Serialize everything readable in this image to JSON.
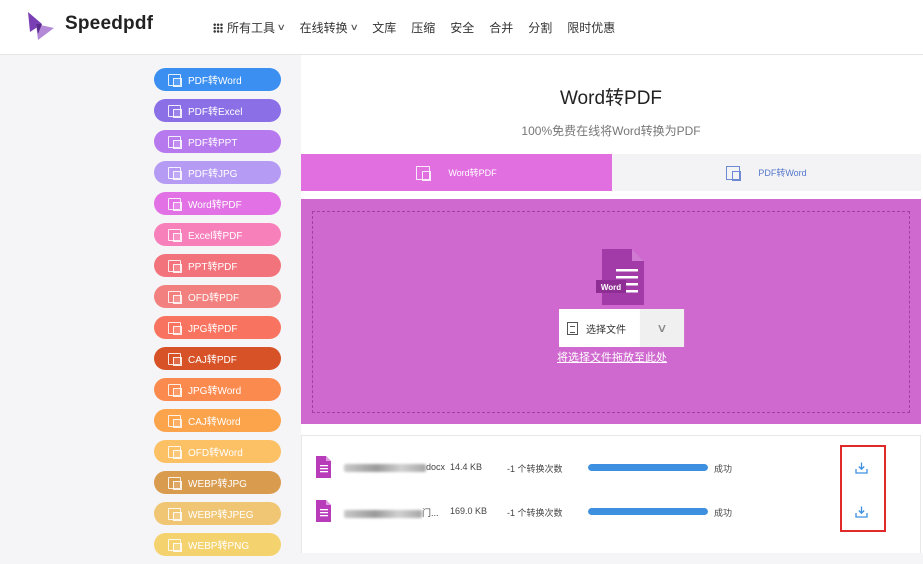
{
  "header": {
    "brand": "Speedpdf",
    "nav": [
      {
        "label": "所有工具",
        "has_grid_icon": true,
        "has_dropdown": true
      },
      {
        "label": "在线转换",
        "has_dropdown": true
      },
      {
        "label": "文库"
      },
      {
        "label": "压缩"
      },
      {
        "label": "安全"
      },
      {
        "label": "合并"
      },
      {
        "label": "分割"
      },
      {
        "label": "限时优惠"
      }
    ]
  },
  "sidebar": {
    "items": [
      {
        "label": "PDF转Word",
        "color": "#3a8ff0"
      },
      {
        "label": "PDF转Excel",
        "color": "#8b6fe6"
      },
      {
        "label": "PDF转PPT",
        "color": "#b679ee"
      },
      {
        "label": "PDF转JPG",
        "color": "#b59bf4"
      },
      {
        "label": "Word转PDF",
        "color": "#e171e4"
      },
      {
        "label": "Excel转PDF",
        "color": "#f77fba"
      },
      {
        "label": "PPT转PDF",
        "color": "#f2737b"
      },
      {
        "label": "OFD转PDF",
        "color": "#f2807f"
      },
      {
        "label": "JPG转PDF",
        "color": "#f97460"
      },
      {
        "label": "CAJ转PDF",
        "color": "#d75227"
      },
      {
        "label": "JPG转Word",
        "color": "#fb8a4e"
      },
      {
        "label": "CAJ转Word",
        "color": "#fba44b"
      },
      {
        "label": "OFD转Word",
        "color": "#fcc065"
      },
      {
        "label": "WEBP转JPG",
        "color": "#d99b4e"
      },
      {
        "label": "WEBP转JPEG",
        "color": "#f0c674"
      },
      {
        "label": "WEBP转PNG",
        "color": "#f4d26e"
      }
    ]
  },
  "main": {
    "title": "Word转PDF",
    "subtitle": "100%免费在线将Word转换为PDF",
    "tabs": [
      {
        "label": "Word转PDF",
        "active": true
      },
      {
        "label": "PDF转Word",
        "active": false
      }
    ],
    "drop": {
      "icon_label": "Word",
      "select_label": "选择文件",
      "hint": "将选择文件拖放至此处"
    },
    "files": [
      {
        "name": "docx",
        "name_prefix_blurred": true,
        "size": "14.4 KB",
        "cost": "-1 个转换次数",
        "progress": 1.0,
        "status": "成功"
      },
      {
        "name": "门...",
        "name_prefix_blurred": true,
        "size": "169.0 KB",
        "cost": "-1 个转换次数",
        "progress": 1.0,
        "status": "成功"
      }
    ]
  },
  "colors": {
    "accent": "#e26fe0",
    "drop_bg": "#d069cf",
    "progress": "#3d8fe0",
    "highlight_box": "#e02a2a",
    "download_icon": "#3d8fe0"
  }
}
